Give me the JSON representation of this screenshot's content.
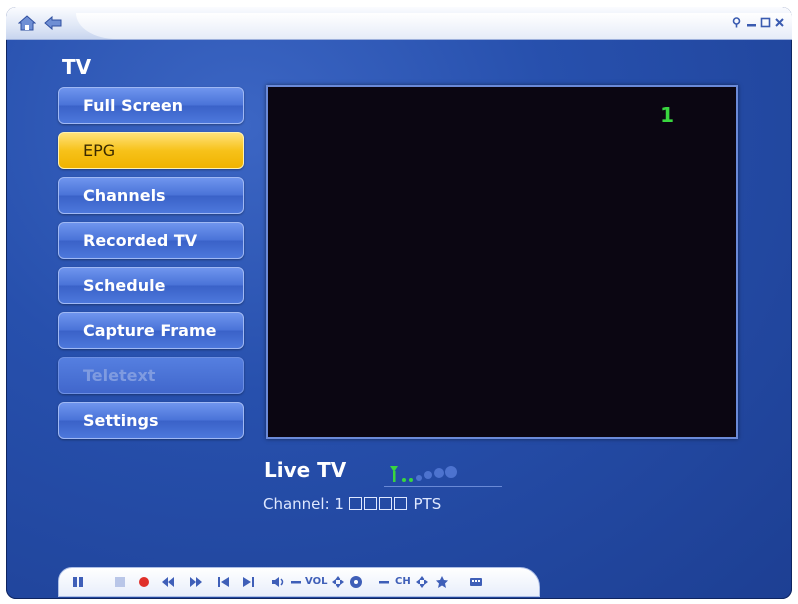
{
  "window": {
    "title_icons": [
      "home-icon",
      "back-icon"
    ],
    "controls": [
      "help-icon",
      "minimize-icon",
      "maximize-icon",
      "close-icon"
    ]
  },
  "page": {
    "title": "TV"
  },
  "menu": {
    "items": [
      {
        "label": "Full Screen",
        "state": "normal"
      },
      {
        "label": "EPG",
        "state": "active"
      },
      {
        "label": "Channels",
        "state": "normal"
      },
      {
        "label": "Recorded TV",
        "state": "normal"
      },
      {
        "label": "Schedule",
        "state": "normal"
      },
      {
        "label": "Capture Frame",
        "state": "normal"
      },
      {
        "label": "Teletext",
        "state": "disabled"
      },
      {
        "label": "Settings",
        "state": "normal"
      }
    ]
  },
  "video": {
    "channel_number": "1"
  },
  "status": {
    "live_label": "Live TV",
    "channel_text": "Channel: 1",
    "pts_label": "PTS"
  },
  "transport": {
    "vol_label": "VOL",
    "ch_label": "CH",
    "icons": [
      "pause-icon",
      "stop-icon",
      "record-icon",
      "rewind-icon",
      "fast-forward-icon",
      "previous-icon",
      "next-icon",
      "speaker-icon",
      "volume-down-icon",
      "volume-up-icon",
      "mute-icon",
      "channel-down-icon",
      "channel-up-icon",
      "favorite-icon",
      "keyboard-icon"
    ]
  },
  "colors": {
    "accent_active": "#f7c21a",
    "osd_green": "#39d63f",
    "background": "#2750ad"
  }
}
